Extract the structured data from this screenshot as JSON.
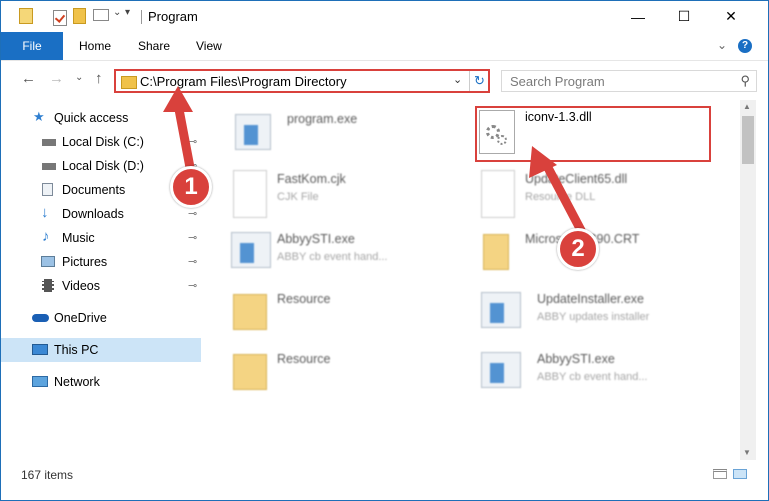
{
  "window": {
    "title": "Program",
    "minimize": "—",
    "maximize": "☐",
    "close": "✕"
  },
  "ribbon": {
    "tabs": [
      {
        "label": "File"
      },
      {
        "label": "Home"
      },
      {
        "label": "Share"
      },
      {
        "label": "View"
      }
    ],
    "expand": "⌄",
    "help": "?"
  },
  "nav": {
    "back": "←",
    "forward": "→",
    "recent": "⌄",
    "up": "↑",
    "address": "C:\\Program Files\\Program Directory",
    "address_dropdown": "⌄",
    "refresh": "↻",
    "search_placeholder": "Search Program",
    "search_icon": "⚲"
  },
  "sidebar": {
    "items": [
      {
        "label": "Quick access",
        "icon": "star-icon"
      },
      {
        "label": "Local Disk (C:)",
        "icon": "drive-icon"
      },
      {
        "label": "Local Disk (D:)",
        "icon": "drive-icon"
      },
      {
        "label": "Documents",
        "icon": "documents-icon"
      },
      {
        "label": "Downloads",
        "icon": "download-icon"
      },
      {
        "label": "Music",
        "icon": "music-icon"
      },
      {
        "label": "Pictures",
        "icon": "pictures-icon"
      },
      {
        "label": "Videos",
        "icon": "videos-icon"
      },
      {
        "label": "OneDrive",
        "icon": "cloud-icon"
      },
      {
        "label": "This PC",
        "icon": "computer-icon"
      },
      {
        "label": "Network",
        "icon": "network-icon"
      }
    ],
    "pin": "📌"
  },
  "files": [
    {
      "name": "program.exe",
      "sub": ""
    },
    {
      "name": "iconv-1.3.dll",
      "sub": ""
    },
    {
      "name": "FastKom.cjk",
      "sub": "CJK File"
    },
    {
      "name": "UpdateClient65.dll",
      "sub": "Resource DLL"
    },
    {
      "name": "AbbyySTI.exe",
      "sub": "ABBY cb event hand..."
    },
    {
      "name": "Microsoft.VC90.CRT",
      "sub": ""
    },
    {
      "name": "Resource",
      "sub": ""
    },
    {
      "name": "UpdateInstaller.exe",
      "sub": "ABBY updates installer"
    },
    {
      "name": "Resource",
      "sub": ""
    },
    {
      "name": "AbbyySTI.exe",
      "sub": "ABBY cb event hand..."
    }
  ],
  "status": {
    "count": "167 items"
  },
  "annotations": {
    "step1": "1",
    "step2": "2",
    "color": "#d9413c"
  }
}
